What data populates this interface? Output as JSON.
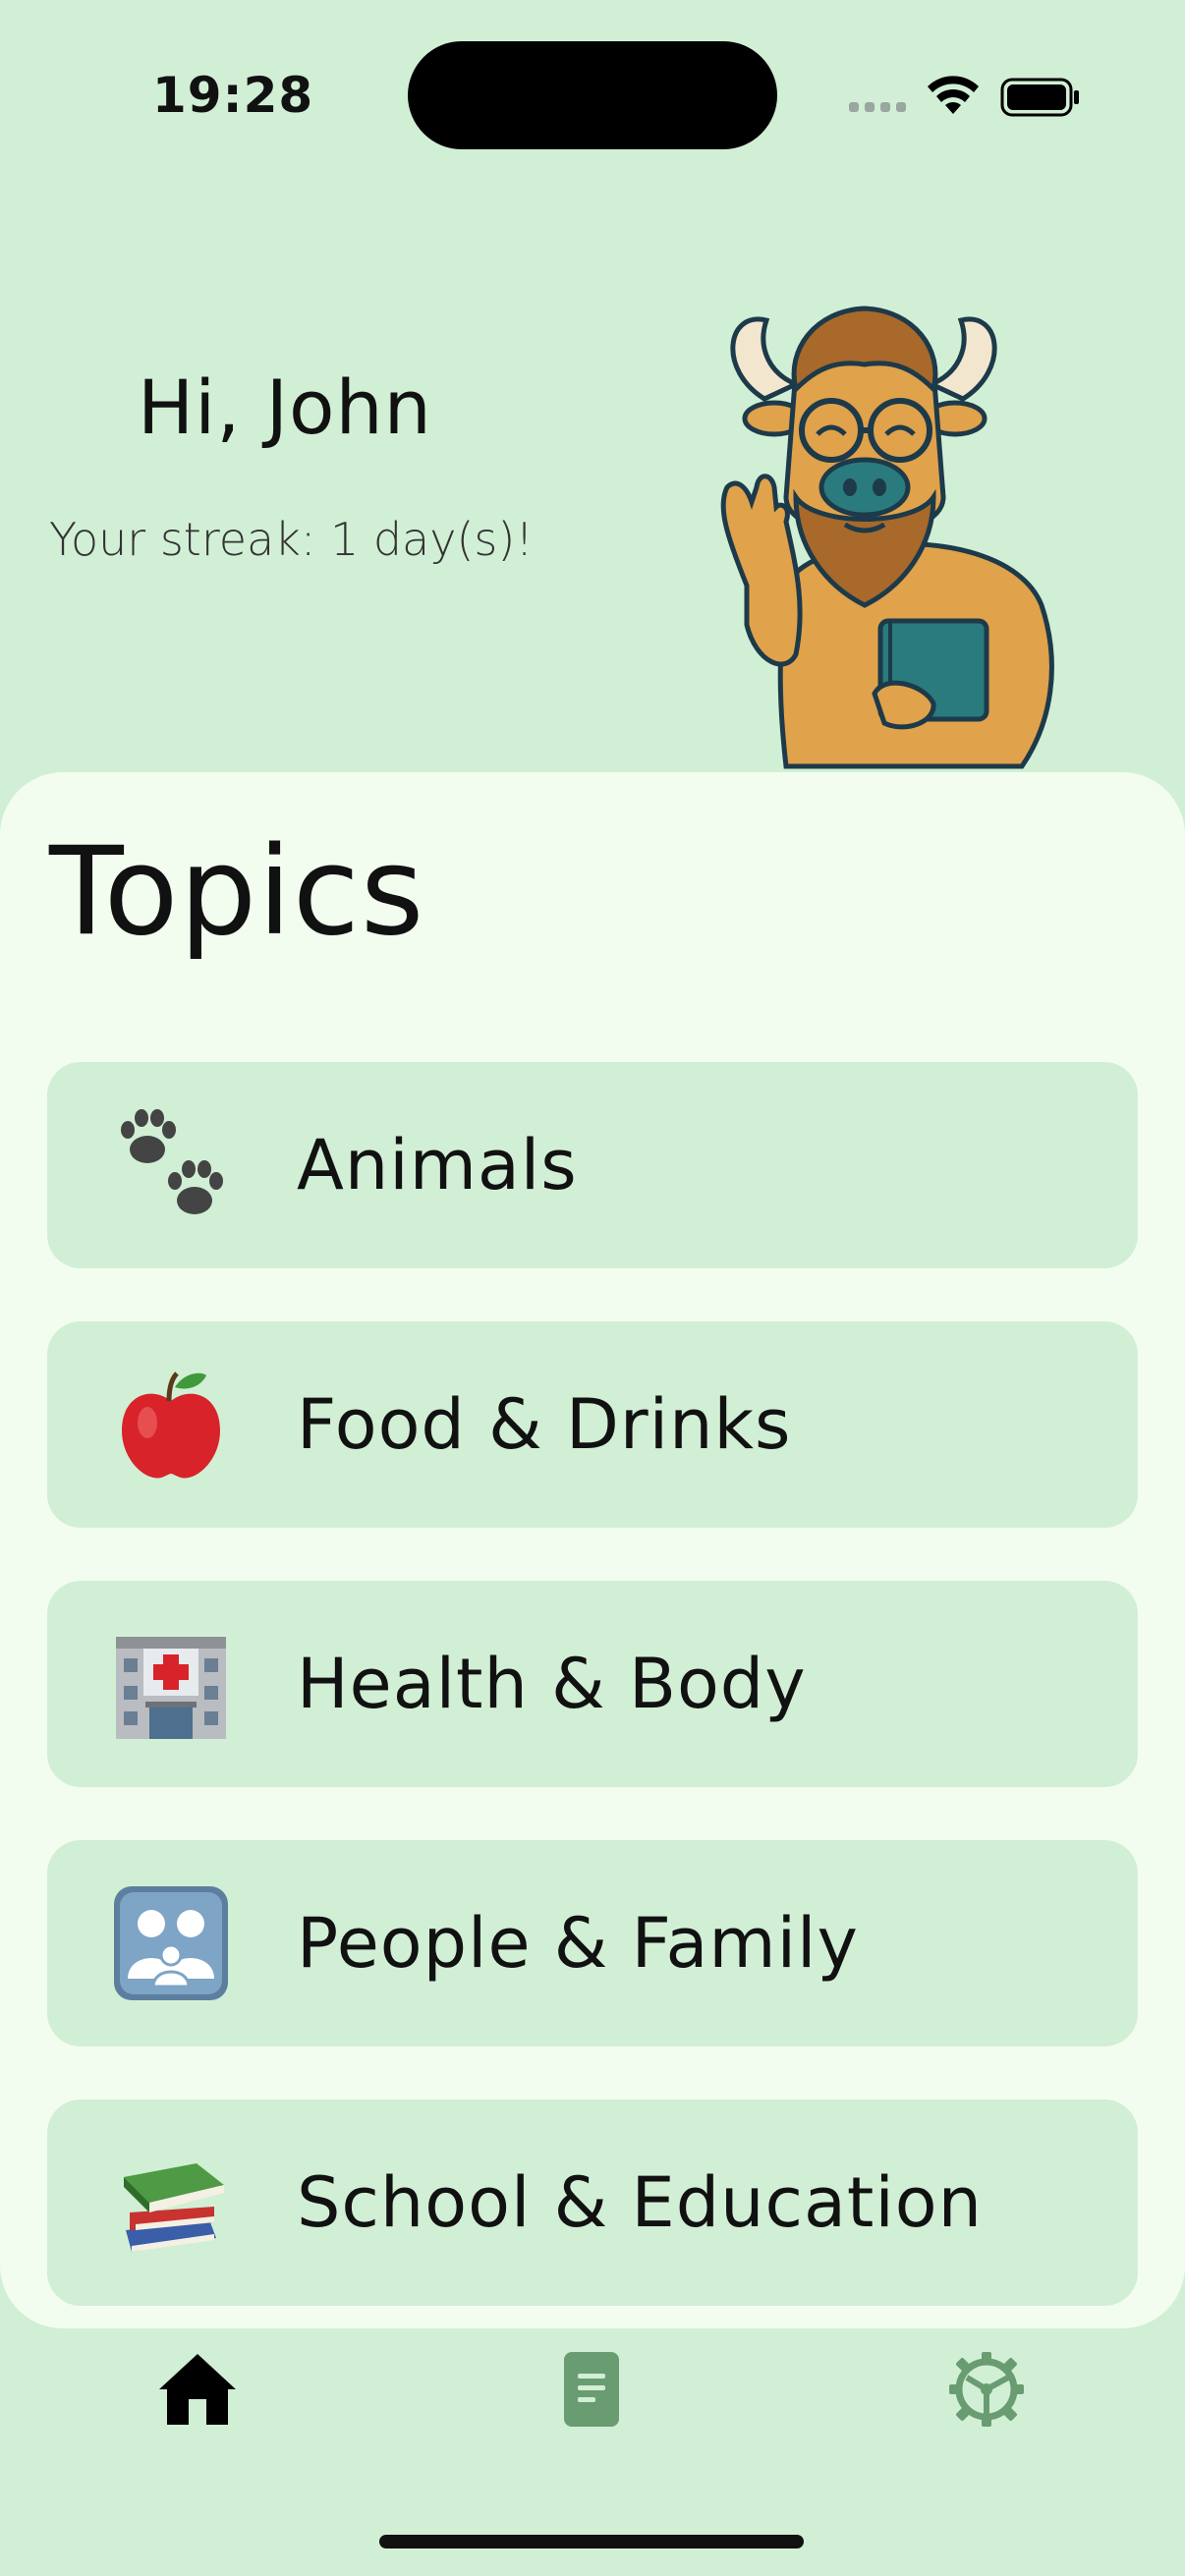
{
  "status_bar": {
    "time": "19:28"
  },
  "greeting": {
    "title": "Hi, John",
    "streak": "Your streak: 1 day(s)!"
  },
  "topics": {
    "title": "Topics",
    "items": [
      {
        "label": "Animals",
        "icon": "paw-prints-icon"
      },
      {
        "label": "Food & Drinks",
        "icon": "apple-icon"
      },
      {
        "label": "Health & Body",
        "icon": "hospital-icon"
      },
      {
        "label": "People & Family",
        "icon": "family-icon"
      },
      {
        "label": "School & Education",
        "icon": "books-icon"
      }
    ]
  },
  "tab_bar": {
    "items": [
      {
        "icon": "home-icon",
        "active": true
      },
      {
        "icon": "document-icon",
        "active": false
      },
      {
        "icon": "settings-icon",
        "active": false
      }
    ]
  },
  "colors": {
    "background": "#d1efd5",
    "card": "#f2fdf0",
    "tab_accent": "#6a9c72"
  }
}
